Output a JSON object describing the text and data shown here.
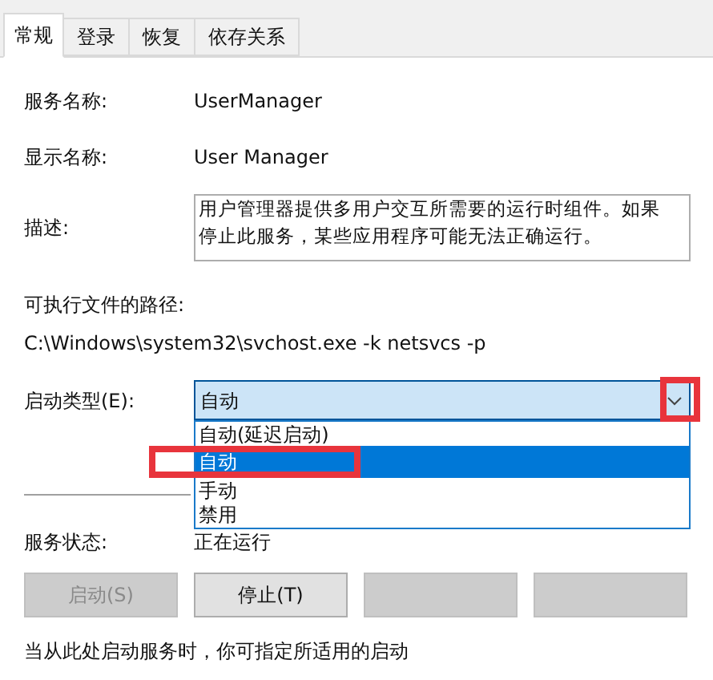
{
  "tabs": [
    {
      "label": "常规",
      "selected": true
    },
    {
      "label": "登录",
      "selected": false
    },
    {
      "label": "恢复",
      "selected": false
    },
    {
      "label": "依存关系",
      "selected": false
    }
  ],
  "service_name": {
    "label": "服务名称:",
    "value": "UserManager"
  },
  "display_name": {
    "label": "显示名称:",
    "value": "User Manager"
  },
  "description": {
    "label": "描述:",
    "value": "用户管理器提供多用户交互所需要的运行时组件。如果停止此服务，某些应用程序可能无法正确运行。"
  },
  "executable_path": {
    "label": "可执行文件的路径:",
    "value": "C:\\Windows\\system32\\svchost.exe -k netsvcs -p"
  },
  "startup_type": {
    "label": "启动类型(E):",
    "value": "自动",
    "expanded": true,
    "options": [
      {
        "label": "自动(延迟启动)",
        "selected": false
      },
      {
        "label": "自动",
        "selected": true
      },
      {
        "label": "手动",
        "selected": false
      },
      {
        "label": "禁用",
        "selected": false
      }
    ]
  },
  "service_status": {
    "label": "服务状态:",
    "value": "正在运行"
  },
  "buttons": [
    {
      "label": "启动(S)",
      "disabled": true
    },
    {
      "label": "停止(T)",
      "disabled": false
    },
    {
      "disabled": true
    },
    {
      "disabled": true
    }
  ],
  "footer_text": "当从此处启动服务时，你可指定所适用的启动"
}
